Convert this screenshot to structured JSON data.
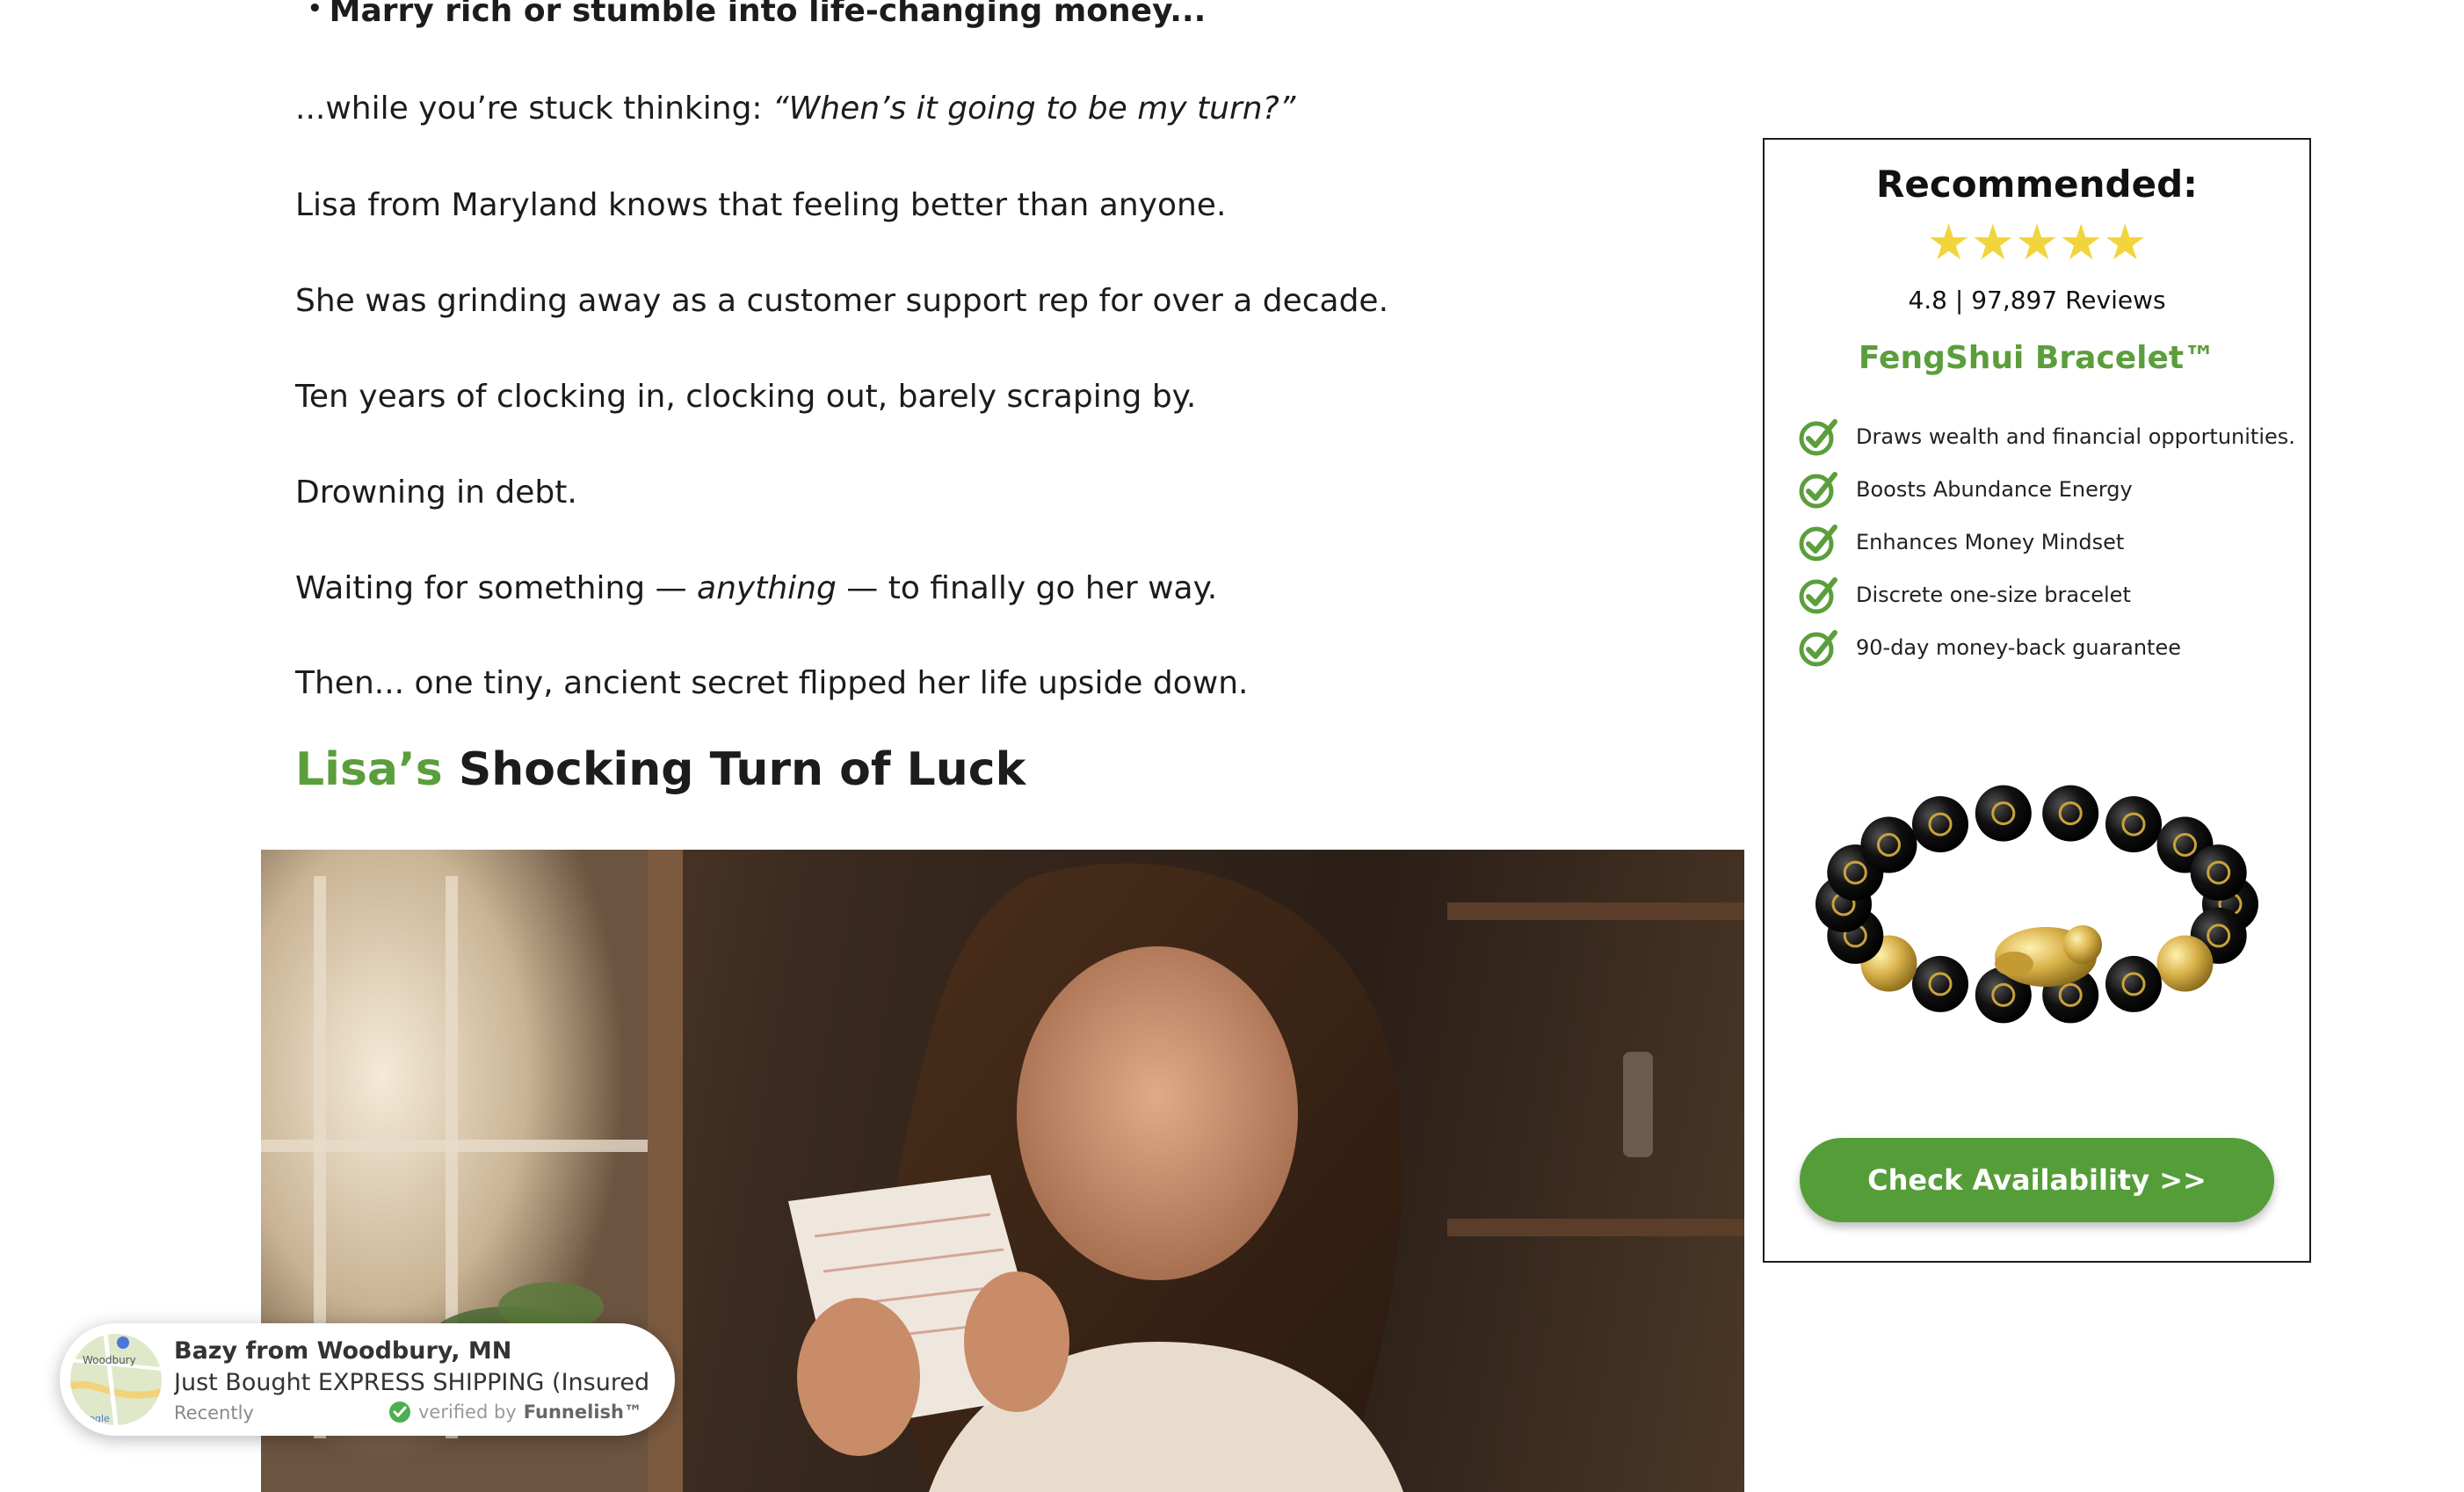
{
  "article": {
    "bullet": "Marry rich or stumble into life-changing money...",
    "p1_lead": "...while you’re stuck thinking: ",
    "p1_quote": "“When’s it going to be my turn?”",
    "p2": "Lisa from Maryland knows that feeling better than anyone.",
    "p3": "She was grinding away as a customer support rep for over a decade.",
    "p4": "Ten years of clocking in, clocking out, barely scraping by.",
    "p5": "Drowning in debt.",
    "p6_a": "Waiting for something — ",
    "p6_b": "anything",
    "p6_c": " — to finally go her way.",
    "p7": "Then... one tiny, ancient secret flipped her life upside down.",
    "headline_green": "Lisa’s",
    "headline_rest": " Shocking Turn of Luck"
  },
  "sidebar": {
    "title": "Recommended:",
    "stars": "★★★★★",
    "rating": 4.8,
    "rating_text": "4.8 | 97,897 Reviews",
    "product_name": "FengShui Bracelet™",
    "features": [
      "Draws wealth and financial opportunities.",
      "Boosts Abundance Energy",
      "Enhances Money Mindset",
      "Discrete one-size bracelet",
      "90-day money-back guarantee"
    ],
    "cta_label": "Check Availability >>"
  },
  "popup": {
    "who": "Bazy from Woodbury, MN",
    "what": "Just Bought EXPRESS SHIPPING (Insured & Tracked)",
    "when": "Recently",
    "verified_prefix": "verified by",
    "verified_brand": "Funnelish™",
    "map_label": "Woodbury",
    "map_brand": "Google"
  },
  "colors": {
    "accent_green": "#5b9e3c",
    "cta_green": "#559d38",
    "star_yellow": "#f2d43c",
    "text": "#1c1c1c"
  },
  "icons": {
    "feature_bullet": "check-circle-icon",
    "verified": "verified-check-icon"
  }
}
